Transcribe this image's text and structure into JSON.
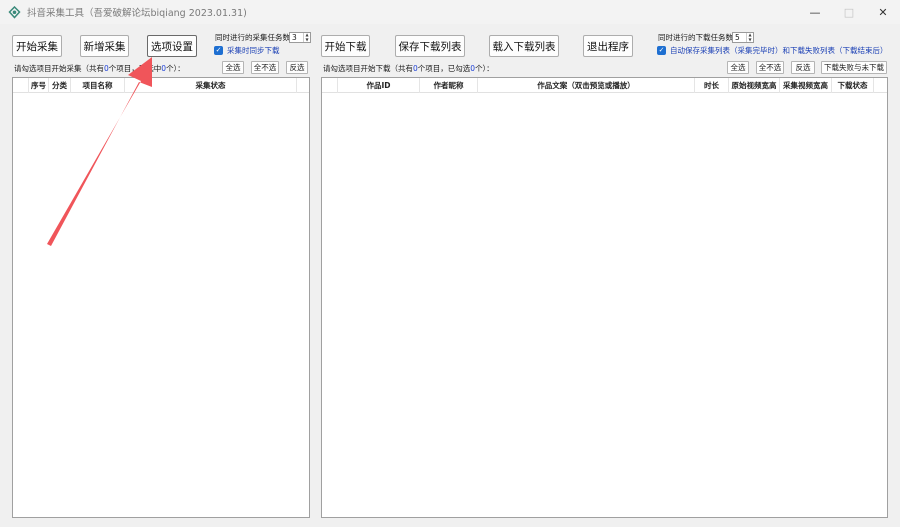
{
  "window": {
    "title": "抖音采集工具（吾爱破解论坛biqiang 2023.01.31)",
    "controls": [
      "minimize",
      "maximize",
      "close"
    ]
  },
  "left": {
    "buttons": {
      "start_collect": "开始采集",
      "add_collect": "新增采集",
      "options": "选项设置"
    },
    "concurrent_label": "同时进行的采集任务数",
    "concurrent_value": "3",
    "sync_download_label": "采集时同步下载",
    "sync_download_checked": true,
    "hint": {
      "prefix": "请勾选项目开始采集（共有",
      "count1": "0",
      "mid": "个项目，已选中",
      "count2": "0",
      "suffix": "个）："
    },
    "select_all": "全选",
    "select_none": "全不选",
    "invert": "反选",
    "columns": [
      "序号",
      "分类",
      "项目名称",
      "采集状态"
    ]
  },
  "right": {
    "buttons": {
      "start_download": "开始下载",
      "save_list": "保存下载列表",
      "load_list": "载入下载列表",
      "exit": "退出程序"
    },
    "concurrent_label": "同时进行的下载任务数",
    "concurrent_value": "5",
    "autosave_label_a": "自动保存采集列表（采集完毕时）",
    "autosave_label_b": "和下载失败列表（下载结束后）",
    "autosave_checked": true,
    "hint": {
      "prefix": "请勾选项目开始下载（共有",
      "count1": "0",
      "mid": "个项目，已勾选",
      "count2": "0",
      "suffix": "个）："
    },
    "select_all": "全选",
    "select_none": "全不选",
    "invert": "反选",
    "failed_undownloaded": "下载失败与未下载",
    "columns": [
      "作品ID",
      "作者昵称",
      "作品文案（双击预览或播放）",
      "时长",
      "原始视频宽高",
      "采集视频宽高",
      "下载状态"
    ]
  },
  "colors": {
    "accent_checkbox": "#1e6fd1",
    "count_blue": "#1c3fd6",
    "arrow_red": "#f0555a"
  }
}
